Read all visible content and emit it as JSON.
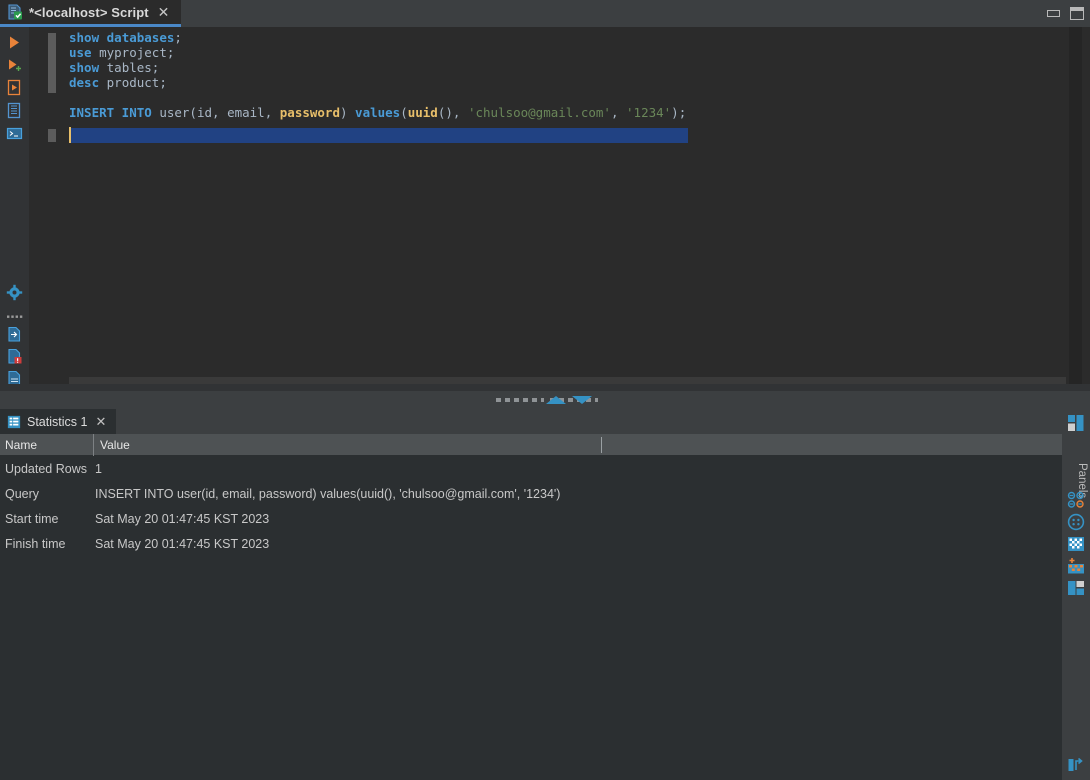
{
  "window": {
    "tab_title": "*<localhost> Script",
    "tab_icon": "sql-script-icon",
    "close_label": "✕",
    "minimize_label": "minimize",
    "maximize_label": "maximize"
  },
  "editor": {
    "lines": [
      [
        {
          "t": "show",
          "c": "kw"
        },
        {
          "t": " ",
          "c": "pl"
        },
        {
          "t": "databases",
          "c": "kw"
        },
        {
          "t": ";",
          "c": "punc"
        }
      ],
      [
        {
          "t": "use",
          "c": "kw"
        },
        {
          "t": " ",
          "c": "pl"
        },
        {
          "t": "myproject",
          "c": "id"
        },
        {
          "t": ";",
          "c": "punc"
        }
      ],
      [
        {
          "t": "show",
          "c": "kw"
        },
        {
          "t": " ",
          "c": "pl"
        },
        {
          "t": "tables",
          "c": "id"
        },
        {
          "t": ";",
          "c": "punc"
        }
      ],
      [
        {
          "t": "desc",
          "c": "kw"
        },
        {
          "t": " ",
          "c": "pl"
        },
        {
          "t": "product",
          "c": "id"
        },
        {
          "t": ";",
          "c": "punc"
        }
      ],
      [],
      [
        {
          "t": "INSERT INTO",
          "c": "kw"
        },
        {
          "t": " user(",
          "c": "id"
        },
        {
          "t": "id, ",
          "c": "id"
        },
        {
          "t": "email",
          "c": "id"
        },
        {
          "t": ", ",
          "c": "id"
        },
        {
          "t": "password",
          "c": "kw2"
        },
        {
          "t": ") ",
          "c": "id"
        },
        {
          "t": "values",
          "c": "kw"
        },
        {
          "t": "(",
          "c": "id"
        },
        {
          "t": "uuid",
          "c": "kw2"
        },
        {
          "t": "(), ",
          "c": "id"
        },
        {
          "t": "'chulsoo@gmail.com'",
          "c": "str"
        },
        {
          "t": ", ",
          "c": "id"
        },
        {
          "t": "'1234'",
          "c": "str"
        },
        {
          "t": ");",
          "c": "id"
        }
      ]
    ],
    "selected_line_text": "INSERT INTO user(id, email, password) values(uuid(), 'chulsoo@gmail.com', '1234');",
    "toolbar_top": [
      {
        "name": "execute-icon",
        "title": "Execute"
      },
      {
        "name": "execute-new-icon",
        "title": "Execute in new tab"
      },
      {
        "name": "run-script-icon",
        "title": "Run script"
      },
      {
        "name": "open-table-editor-icon",
        "title": "Open table editor"
      },
      {
        "name": "open-console-icon",
        "title": "Open console"
      }
    ],
    "toolbar_bottom": [
      {
        "name": "settings-gear-icon",
        "title": "Settings"
      },
      {
        "name": "more-options-icon",
        "title": "More"
      },
      {
        "name": "export-data-icon",
        "title": "Export data"
      },
      {
        "name": "save-file-icon",
        "title": "Save file"
      },
      {
        "name": "csv-file-icon",
        "title": "CSV"
      }
    ]
  },
  "splitter": {
    "collapse_up": "collapse-up-arrow",
    "collapse_down": "collapse-down-arrow"
  },
  "statistics": {
    "tab_label": "Statistics 1",
    "tab_icon": "statistics-table-icon",
    "tab_close": "✕",
    "columns": [
      "Name",
      "Value"
    ],
    "rows": [
      {
        "name": "Updated Rows",
        "value": "1",
        "spanned": true
      },
      {
        "name": "Query",
        "value": "INSERT INTO user(id, email, password) values(uuid(), 'chulsoo@gmail.com', '1234')",
        "spanned": false
      },
      {
        "name": "Start time",
        "value": "Sat May 20 01:47:45 KST 2023",
        "spanned": false
      },
      {
        "name": "Finish time",
        "value": "Sat May 20 01:47:45 KST 2023",
        "spanned": false
      }
    ]
  },
  "right_panel": {
    "label": "Panels",
    "icons": [
      {
        "name": "panels-layout-icon",
        "title": "Panels"
      },
      {
        "name": "data-extractor-icon",
        "title": "Data extractor"
      },
      {
        "name": "value-editor-icon",
        "title": "Value editor"
      },
      {
        "name": "grid-view-icon",
        "title": "Grid view"
      },
      {
        "name": "aggregate-view-icon",
        "title": "Aggregate view"
      },
      {
        "name": "transpose-view-icon",
        "title": "Transpose"
      }
    ],
    "bottom_icon": {
      "name": "toggle-panel-icon",
      "title": "Toggle panel"
    }
  },
  "colors": {
    "accent": "#3592c4",
    "keyword": "#4a9bd6",
    "function": "#e8bf6a",
    "string": "#6a8759",
    "selection": "#214283",
    "editor_bg": "#2b2b2b",
    "panel_bg": "#2b2f31",
    "chrome_bg": "#3c3f41"
  }
}
